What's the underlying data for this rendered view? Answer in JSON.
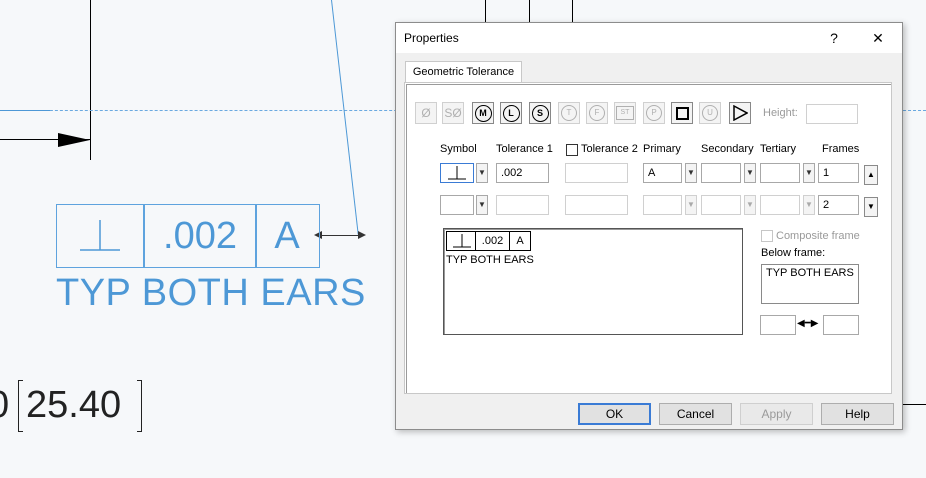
{
  "drawing": {
    "fcf_symbol": "⊥",
    "fcf_tolerance": ".002",
    "fcf_datum": "A",
    "note": "TYP BOTH EARS",
    "dimension_partial": "0",
    "dimension_value": "25.40"
  },
  "dialog": {
    "title": "Properties",
    "help_label": "?",
    "close_label": "✕",
    "tab_label": "Geometric Tolerance",
    "symbols": [
      "Ø",
      "SØ",
      "M",
      "L",
      "S",
      "T",
      "F",
      "ST",
      "P",
      "□",
      "U",
      "▷"
    ],
    "height_label": "Height:",
    "height_value": "",
    "columns": {
      "symbol": "Symbol",
      "tolerance1": "Tolerance 1",
      "tolerance2": "Tolerance 2",
      "primary": "Primary",
      "secondary": "Secondary",
      "tertiary": "Tertiary",
      "frames": "Frames"
    },
    "row1": {
      "symbol": "⊥",
      "tolerance1": ".002",
      "tolerance2": "",
      "primary": "A",
      "secondary": "",
      "tertiary": "",
      "frames": "1"
    },
    "row2": {
      "symbol": "",
      "tolerance1": "",
      "tolerance2": "",
      "primary": "",
      "secondary": "",
      "tertiary": "",
      "frames": "2"
    },
    "preview": {
      "symbol": "⊥",
      "tolerance": ".002",
      "datum": "A",
      "note": "TYP BOTH EARS"
    },
    "composite_frame_label": "Composite frame",
    "below_frame_label": "Below frame:",
    "below_frame_value": "TYP BOTH EARS",
    "arrow_symbol": "◀━▶",
    "buttons": {
      "ok": "OK",
      "cancel": "Cancel",
      "apply": "Apply",
      "help": "Help"
    }
  }
}
